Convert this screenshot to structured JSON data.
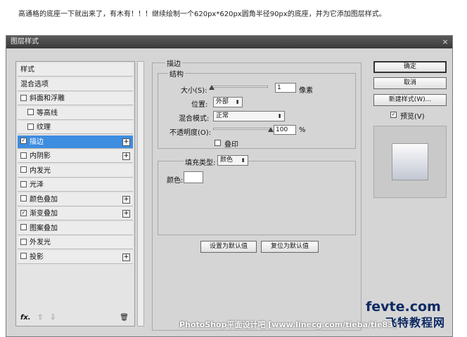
{
  "caption": "高通格的底座一下就出来了，有木有！！！继续绘制一个620px*620px圆角半径90px的底座，并为它添加图层样式。",
  "dialog": {
    "title": "图层样式",
    "close": "×"
  },
  "styles_list": [
    {
      "label": "样式",
      "checkbox": false,
      "checked": false,
      "plus": false,
      "indent": false,
      "selected": false
    },
    {
      "label": "混合选项",
      "checkbox": false,
      "checked": false,
      "plus": false,
      "indent": false,
      "selected": false
    },
    {
      "label": "斜面和浮雕",
      "checkbox": true,
      "checked": false,
      "plus": false,
      "indent": false,
      "selected": false
    },
    {
      "label": "等高线",
      "checkbox": true,
      "checked": false,
      "plus": false,
      "indent": true,
      "selected": false
    },
    {
      "label": "纹理",
      "checkbox": true,
      "checked": false,
      "plus": false,
      "indent": true,
      "selected": false
    },
    {
      "label": "描边",
      "checkbox": true,
      "checked": true,
      "plus": true,
      "indent": false,
      "selected": true
    },
    {
      "label": "内阴影",
      "checkbox": true,
      "checked": false,
      "plus": true,
      "indent": false,
      "selected": false
    },
    {
      "label": "内发光",
      "checkbox": true,
      "checked": false,
      "plus": false,
      "indent": false,
      "selected": false
    },
    {
      "label": "光泽",
      "checkbox": true,
      "checked": false,
      "plus": false,
      "indent": false,
      "selected": false
    },
    {
      "label": "颜色叠加",
      "checkbox": true,
      "checked": false,
      "plus": true,
      "indent": false,
      "selected": false
    },
    {
      "label": "渐变叠加",
      "checkbox": true,
      "checked": true,
      "plus": true,
      "indent": false,
      "selected": false
    },
    {
      "label": "图案叠加",
      "checkbox": true,
      "checked": false,
      "plus": false,
      "indent": false,
      "selected": false
    },
    {
      "label": "外发光",
      "checkbox": true,
      "checked": false,
      "plus": false,
      "indent": false,
      "selected": false
    },
    {
      "label": "投影",
      "checkbox": true,
      "checked": false,
      "plus": true,
      "indent": false,
      "selected": false
    }
  ],
  "bottom_tools": {
    "fx": "fx.",
    "up": "⇧",
    "down": "⇩",
    "trash": "🗑"
  },
  "stroke": {
    "section_title": "描边",
    "structure_title": "结构",
    "size_label": "大小(S):",
    "size_value": "1",
    "size_unit": "像素",
    "size_level": 0,
    "position_label": "位置:",
    "position_value": "外部",
    "blend_label": "混合模式:",
    "blend_value": "正常",
    "opacity_label": "不透明度(O):",
    "opacity_value": "100",
    "opacity_unit": "%",
    "opacity_level": 100,
    "overprint_label": "叠印",
    "fill_type_label": "填充类型:",
    "fill_type_value": "颜色",
    "color_label": "颜色:",
    "color_value": "#ffffff",
    "set_default": "设置为默认值",
    "reset_default": "复位为默认值"
  },
  "right_buttons": {
    "ok": "确定",
    "cancel": "取消",
    "new_style": "新建样式(W)...",
    "preview_label": "预览(V)",
    "preview_checked": true
  },
  "watermark": "PhotoShop平面设计吧 [www.linecg.com/tieba/tie83]",
  "logo": {
    "top": "fevte.com",
    "bottom": "飞特教程网"
  }
}
